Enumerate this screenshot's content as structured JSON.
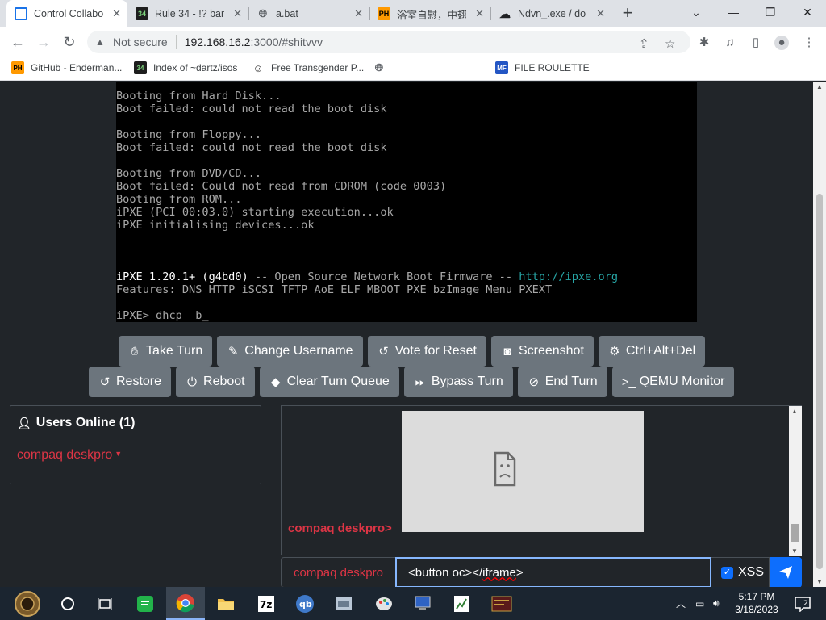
{
  "browser": {
    "tabs": [
      {
        "title": "Control Collabo",
        "icon": "monitor-icon",
        "active": true
      },
      {
        "title": "Rule 34 - !? ban",
        "icon": "rule34-icon",
        "active": false
      },
      {
        "title": "a.bat",
        "icon": "globe-icon",
        "active": false
      },
      {
        "title": "浴室自慰，中翅",
        "icon": "ph-icon",
        "active": false
      },
      {
        "title": "Ndvn_.exe / do",
        "icon": "cloud-icon",
        "active": false
      }
    ],
    "new_tab": "+",
    "address": {
      "security_label": "Not secure",
      "host": "192.168.16.2",
      "path": ":3000/#shitvvv"
    },
    "bookmarks": [
      {
        "label": "GitHub - Enderman...",
        "icon": "ph-icon"
      },
      {
        "label": "Index of ~dartz/isos",
        "icon": "dir-icon"
      },
      {
        "label": "Free Transgender P...",
        "icon": "site-icon"
      },
      {
        "label": "",
        "icon": "globe-icon"
      },
      {
        "label": "FILE ROULETTE",
        "icon": "mft-icon"
      }
    ]
  },
  "vm_console": {
    "lines": [
      {
        "text": "Booting from Hard Disk...",
        "y": 0
      },
      {
        "text": "Boot failed: could not read the boot disk",
        "y": 1
      },
      {
        "text": "Booting from Floppy...",
        "y": 3
      },
      {
        "text": "Boot failed: could not read the boot disk",
        "y": 4
      },
      {
        "text": "Booting from DVD/CD...",
        "y": 6
      },
      {
        "text": "Boot failed: Could not read from CDROM (code 0003)",
        "y": 7
      },
      {
        "text": "Booting from ROM...",
        "y": 8
      },
      {
        "text": "iPXE (PCI 00:03.0) starting execution...ok",
        "y": 9
      },
      {
        "text": "iPXE initialising devices...ok",
        "y": 10
      }
    ],
    "ipxe_banner": {
      "name": "iPXE 1.20.1+ (g4bd0)",
      "middle": " -- Open Source Network Boot Firmware -- ",
      "url": "http://ipxe.org"
    },
    "features": "Features: DNS HTTP iSCSI TFTP AoE ELF MBOOT PXE bzImage Menu PXEXT",
    "prompt": "iPXE> dhcp  b_"
  },
  "controls": {
    "row1": [
      {
        "label": "Take Turn",
        "icon": "hand-icon"
      },
      {
        "label": "Change Username",
        "icon": "user-edit-icon"
      },
      {
        "label": "Vote for Reset",
        "icon": "undo-icon"
      },
      {
        "label": "Screenshot",
        "icon": "camera-icon"
      },
      {
        "label": "Ctrl+Alt+Del",
        "icon": "gear-icon"
      }
    ],
    "row2": [
      {
        "label": "Restore",
        "icon": "undo-icon"
      },
      {
        "label": "Reboot",
        "icon": "power-icon"
      },
      {
        "label": "Clear Turn Queue",
        "icon": "eraser-icon"
      },
      {
        "label": "Bypass Turn",
        "icon": "forward-icon"
      },
      {
        "label": "End Turn",
        "icon": "ban-icon"
      },
      {
        "label": "QEMU Monitor",
        "icon": "terminal-icon"
      }
    ]
  },
  "users_panel": {
    "title": "Users Online (1)",
    "users": [
      "compaq deskpro"
    ]
  },
  "chat": {
    "sender": "compaq deskpro>"
  },
  "chat_input": {
    "username": "compaq deskpro",
    "message_prefix": "<button oc></",
    "message_underlined": "iframe",
    "message_suffix": ">",
    "xss_label": "XSS",
    "xss_checked": true
  },
  "taskbar": {
    "time": "5:17 PM",
    "date": "3/18/2023"
  },
  "colors": {
    "accent": "#0d6efd",
    "username_red": "#dc3545",
    "button_gray": "#6c757d",
    "page_bg": "#212529"
  }
}
